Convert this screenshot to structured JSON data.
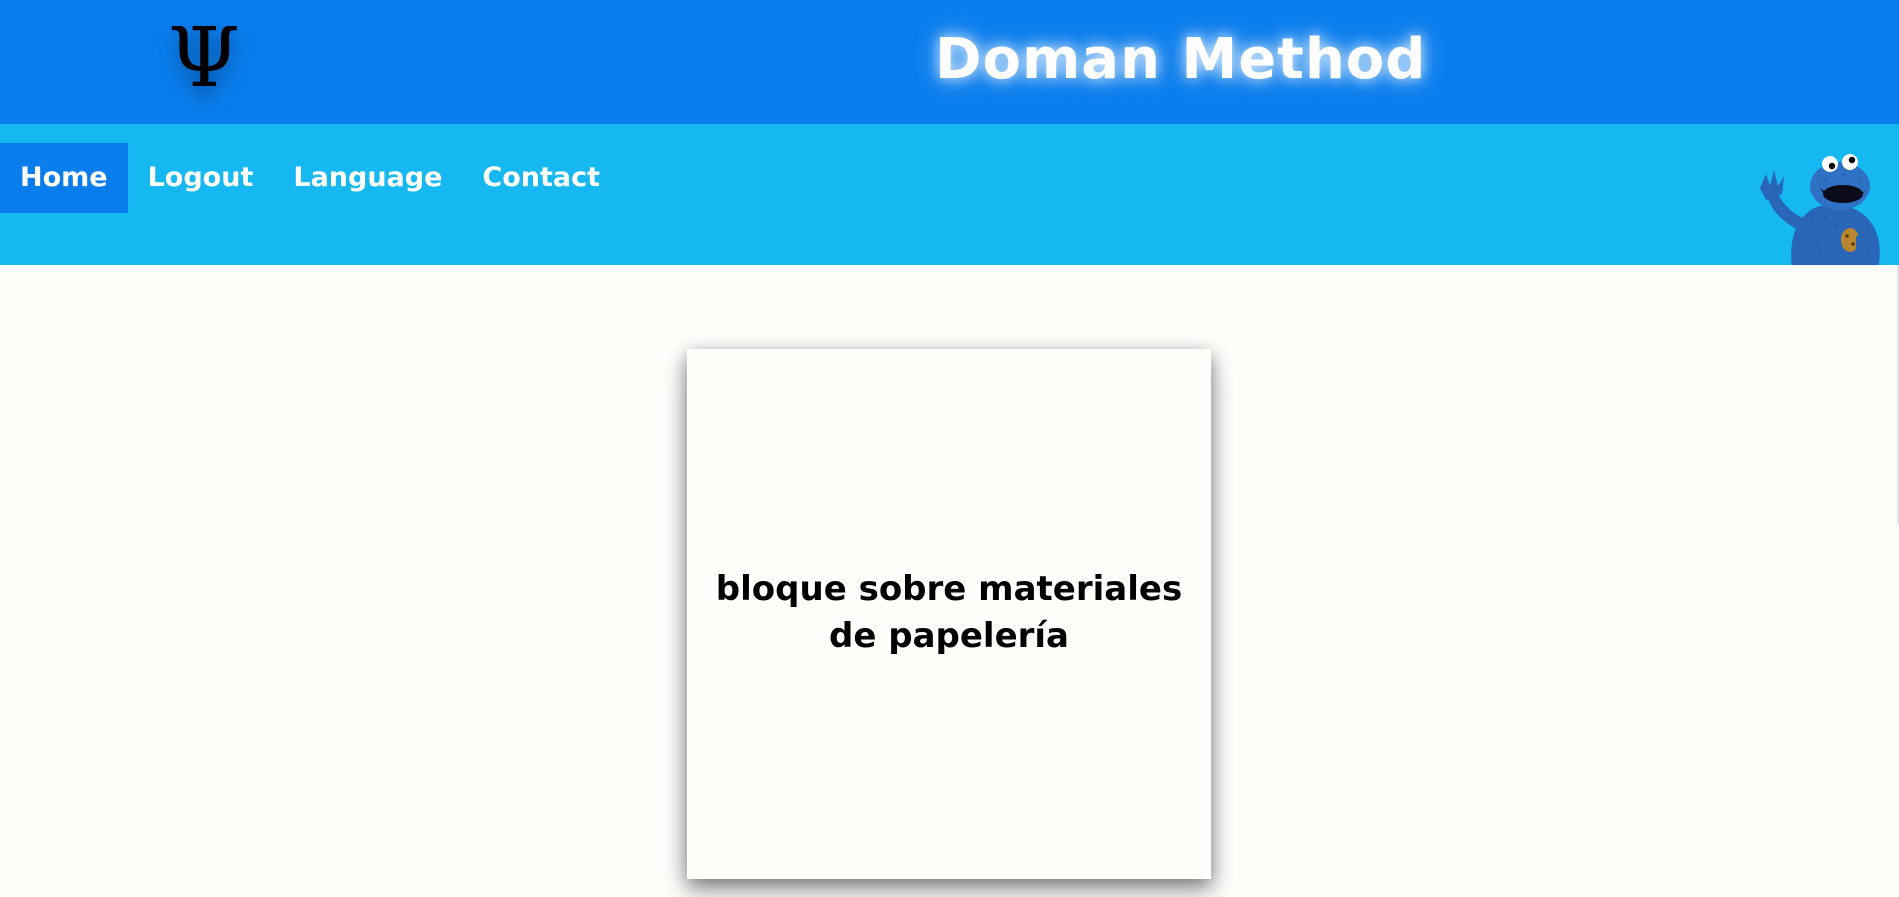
{
  "header": {
    "logo_glyph": "Ψ",
    "title": "Doman Method",
    "bg_color": "#0a7ded"
  },
  "nav": {
    "bg_color": "#16b8f2",
    "items": [
      {
        "label": "Home",
        "active": true
      },
      {
        "label": "Logout",
        "active": false
      },
      {
        "label": "Language",
        "active": false
      },
      {
        "label": "Contact",
        "active": false
      }
    ],
    "mascot_icon": "cookie-monster-icon"
  },
  "main": {
    "card": {
      "text": "bloque sobre materiales de papelería"
    }
  }
}
